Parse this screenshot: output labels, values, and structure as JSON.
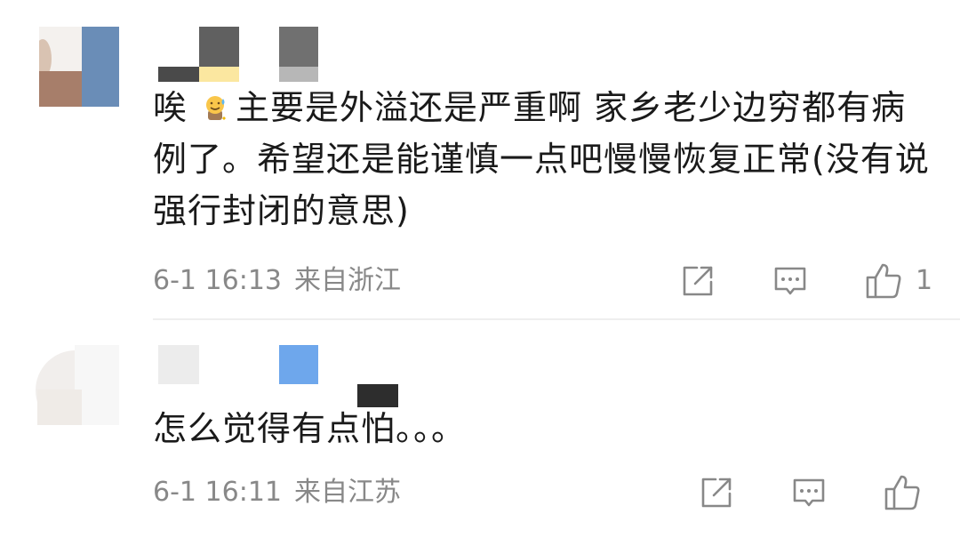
{
  "comments": [
    {
      "text": "唉 主要是外溢还是严重啊 家乡老少边穷都有病例了。希望还是能谨慎一点吧慢慢恢复正常(没有说强行封闭的意思)",
      "text_before_emoji": "唉",
      "text_after_emoji": "主要是外溢还是严重啊 家乡老少边穷都有病例了。希望还是能谨慎一点吧慢慢恢复正常(没有说强行封闭的意思)",
      "emoji": "sweat-smile-emoji",
      "time": "6-1 16:13",
      "location": "来自浙江",
      "like_count": "1"
    },
    {
      "text": "怎么觉得有点怕。。。",
      "time": "6-1 16:11",
      "location": "来自江苏",
      "like_count": ""
    }
  ],
  "icons": {
    "share": "share-icon",
    "reply": "comment-icon",
    "like": "thumbs-up-icon"
  },
  "colors": {
    "text": "#1a1a1a",
    "meta": "#888888",
    "divider": "#eeeeee",
    "icon": "#888888"
  }
}
